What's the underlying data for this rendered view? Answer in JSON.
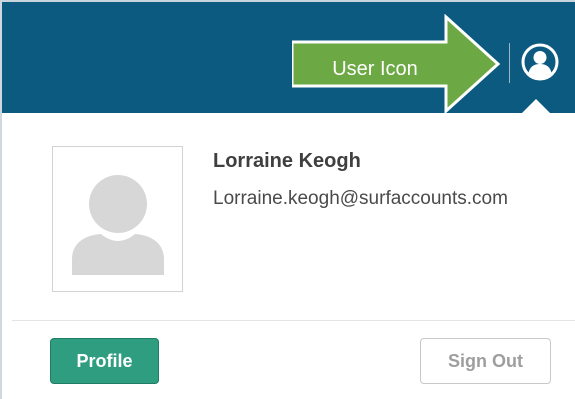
{
  "callout": {
    "label": "User Icon",
    "color": "#6ca843"
  },
  "header": {
    "background_color": "#0c5a80",
    "user_icon": "user-circle-icon"
  },
  "profile_panel": {
    "avatar_icon": "default-avatar-icon",
    "name": "Lorraine Keogh",
    "email": "Lorraine.keogh@surfaccounts.com"
  },
  "actions": {
    "profile_label": "Profile",
    "profile_color": "#2f9e80",
    "signout_label": "Sign Out"
  }
}
